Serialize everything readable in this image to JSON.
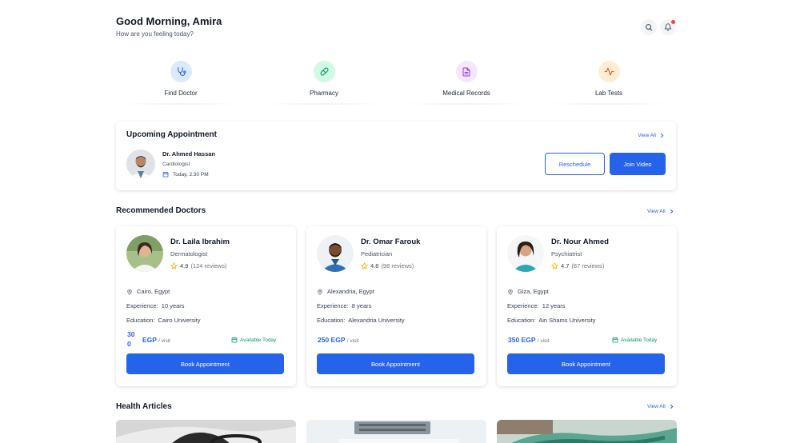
{
  "header": {
    "greeting": "Good Morning, Amira",
    "subtitle": "How are you feeling today?",
    "search_icon": "search-icon",
    "notification_icon": "bell-icon"
  },
  "quick_actions": [
    {
      "label": "Find Doctor",
      "icon": "stethoscope-icon",
      "color": "#2563eb",
      "bg": "#dbeafe"
    },
    {
      "label": "Pharmacy",
      "icon": "pill-icon",
      "color": "#059669",
      "bg": "#d1fae5"
    },
    {
      "label": "Medical Records",
      "icon": "document-icon",
      "color": "#9333ea",
      "bg": "#f3e8ff"
    },
    {
      "label": "Lab Tests",
      "icon": "activity-icon",
      "color": "#ea580c",
      "bg": "#ffedd5"
    }
  ],
  "upcoming": {
    "title": "Upcoming Appointment",
    "view_all": "View All",
    "doctor_name": "Dr. Ahmed Hassan",
    "specialty": "Cardiologist",
    "time": "Today, 2:30 PM",
    "reschedule": "Reschedule",
    "join": "Join Video"
  },
  "recommended": {
    "title": "Recommended Doctors",
    "view_all": "View All",
    "experience_label": "Experience:",
    "education_label": "Education:",
    "per_visit": "/ visit",
    "book": "Book Appointment",
    "doctors": [
      {
        "name": "Dr. Laila Ibrahim",
        "specialty": "Dermatologist",
        "rating": "4.9",
        "reviews": "(124  reviews)",
        "location": "Cairo, Egypt",
        "experience": "10 years",
        "education": "Cairo University",
        "price_amount_line1": "30",
        "price_amount_line2": "0",
        "currency": "EGP",
        "availability": "Available Today"
      },
      {
        "name": "Dr. Omar Farouk",
        "specialty": "Pediatrician",
        "rating": "4.8",
        "reviews": "(98 reviews)",
        "location": "Alexandria, Egypt",
        "experience": "8 years",
        "education": "Alexandria University",
        "price": "250 EGP"
      },
      {
        "name": "Dr. Nour Ahmed",
        "specialty": "Psychiatrist",
        "rating": "4.7",
        "reviews": "(87 reviews)",
        "location": "Giza, Egypt",
        "experience": "12 years",
        "education": "Ain Shams University",
        "price": "350 EGP",
        "availability": "Available Today"
      }
    ]
  },
  "articles": {
    "title": "Health Articles",
    "view_all": "View All"
  },
  "colors": {
    "accent": "#2563eb",
    "success": "#059669",
    "star": "#f5b301",
    "alert": "#ef4444"
  }
}
